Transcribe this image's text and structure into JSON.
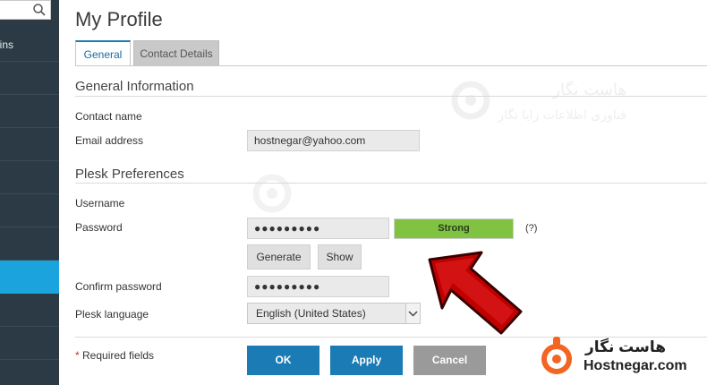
{
  "sidebar": {
    "search_icon": "search-icon",
    "items": [
      {
        "label": "ains",
        "active": false
      },
      {
        "label": "",
        "active": false
      },
      {
        "label": "",
        "active": false
      },
      {
        "label": "",
        "active": false
      },
      {
        "label": "",
        "active": false
      },
      {
        "label": "",
        "active": false
      },
      {
        "label": "",
        "active": false
      },
      {
        "label": "",
        "active": true
      },
      {
        "label": "",
        "active": false
      },
      {
        "label": "",
        "active": false
      }
    ]
  },
  "page": {
    "title": "My Profile",
    "tabs": [
      {
        "label": "General",
        "active": true
      },
      {
        "label": "Contact Details",
        "active": false
      }
    ]
  },
  "general_info": {
    "title": "General Information",
    "contact_name_label": "Contact name",
    "email_label": "Email address",
    "email_value": "hostnegar@yahoo.com"
  },
  "plesk_prefs": {
    "title": "Plesk Preferences",
    "username_label": "Username",
    "password_label": "Password",
    "password_value": "●●●●●●●●●",
    "strength": "Strong",
    "help": "(?)",
    "generate_label": "Generate",
    "show_label": "Show",
    "confirm_label": "Confirm password",
    "confirm_value": "●●●●●●●●●",
    "language_label": "Plesk language",
    "language_value": "English (United States)"
  },
  "footer": {
    "required_star": "*",
    "required_text": "Required fields",
    "ok_label": "OK",
    "apply_label": "Apply",
    "cancel_label": "Cancel"
  },
  "watermark": {
    "line1": "هاست نگار",
    "line2": "فناوری اطلاعات رایا نگار"
  },
  "brand": {
    "name_fa": "هاست نگار",
    "name_en": "Hostnegar.com"
  },
  "colors": {
    "primary": "#1a7bb5",
    "strength_green": "#80c341",
    "sidebar_bg": "#2b3a44",
    "sidebar_active": "#1aa3dc",
    "arrow_red": "#c00000",
    "brand_orange": "#f26522"
  }
}
